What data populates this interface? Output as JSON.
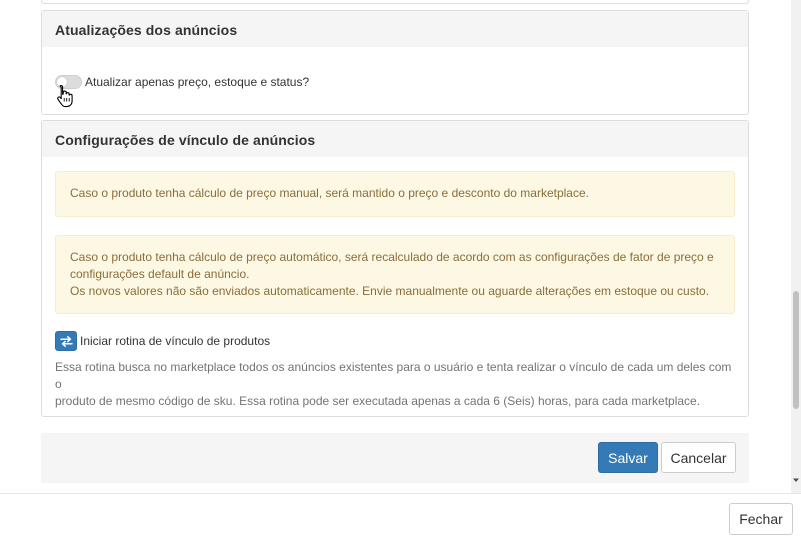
{
  "updates_panel": {
    "title": "Atualizações dos anúncios",
    "toggle_label": "Atualizar apenas preço, estoque e status?",
    "toggle_on": false
  },
  "link_panel": {
    "title": "Configurações de vínculo de anúncios",
    "alert_manual": "Caso o produto tenha cálculo de preço manual, será mantido o preço e desconto do marketplace.",
    "alert_auto_line1": "Caso o produto tenha cálculo de preço automático, será recalculado de acordo com as configurações de fator de preço e",
    "alert_auto_line2": "configurações default de anúncio.",
    "alert_auto_line3": "Os novos valores não são enviados automaticamente. Envie manualmente ou aguarde alterações em estoque ou custo.",
    "routine_label": "Iniciar rotina de vínculo de produtos",
    "help_line1": "Essa rotina busca no marketplace todos os anúncios existentes para o usuário e tenta realizar o vínculo de cada um deles com o",
    "help_line2": "produto de mesmo código de sku. Essa rotina pode ser executada apenas a cada 6 (Seis) horas, para cada marketplace."
  },
  "form_actions": {
    "save_label": "Salvar",
    "cancel_label": "Cancelar"
  },
  "modal_footer": {
    "close_label": "Fechar"
  },
  "icons": {
    "routine": "exchange-arrows-icon",
    "cursor": "hand-pointer-icon"
  },
  "colors": {
    "primary": "#337ab7",
    "alert_bg": "#fcf8e3",
    "alert_text": "#8a6d3b",
    "panel_heading_bg": "#f5f5f5"
  }
}
